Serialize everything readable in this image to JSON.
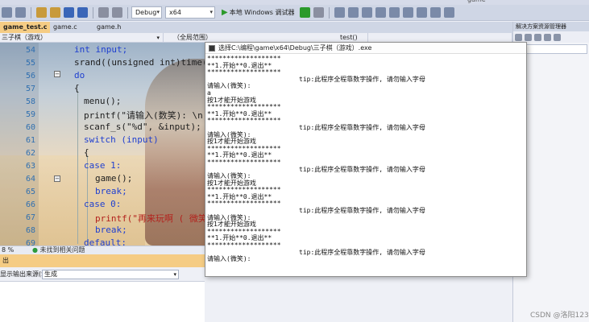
{
  "toolbar": {
    "config": "Debug",
    "platform": "x64",
    "run_label": "本地 Windows 调试器"
  },
  "title_bar": {
    "right_text": "game"
  },
  "tabs": [
    {
      "label": "game_test.c",
      "active": true
    },
    {
      "label": "game.c",
      "active": false
    },
    {
      "label": "game.h",
      "active": false
    }
  ],
  "nav": {
    "project": "三子棋（游戏）",
    "scope": "（全局范围）",
    "member": "test()"
  },
  "editor": {
    "lines": [
      {
        "n": "54",
        "text": "int input;"
      },
      {
        "n": "55",
        "text": "srand((unsigned int)time(NU"
      },
      {
        "n": "56",
        "text": "do"
      },
      {
        "n": "57",
        "text": "{"
      },
      {
        "n": "58",
        "text": "menu();"
      },
      {
        "n": "59",
        "text": "printf(\"请输入(数笑): \\n"
      },
      {
        "n": "60",
        "text": "scanf_s(\"%d\", &input);"
      },
      {
        "n": "61",
        "text": "switch (input)"
      },
      {
        "n": "62",
        "text": "{"
      },
      {
        "n": "63",
        "text": "case 1:"
      },
      {
        "n": "64",
        "text": "game();"
      },
      {
        "n": "65",
        "text": "break;"
      },
      {
        "n": "66",
        "text": "case 0:"
      },
      {
        "n": "67",
        "text": "printf(\"再来玩啊 ( 微笑"
      },
      {
        "n": "68",
        "text": "break;"
      },
      {
        "n": "69",
        "text": "default:"
      }
    ]
  },
  "status": {
    "zoom": "8 %",
    "issues": "未找到相关问题"
  },
  "output_panel": {
    "header": "出",
    "show_from_label": "显示输出来源(S):",
    "source": "生成"
  },
  "console": {
    "title": "选择C:\\编程\\game\\x64\\Debug\\三子棋（游戏）.exe",
    "lines": [
      {
        "text": "*******************",
        "tip": ""
      },
      {
        "text": "**1.开始**0.退出**",
        "tip": ""
      },
      {
        "text": "*******************",
        "tip": ""
      },
      {
        "text": "",
        "tip": "tip:此程序全程靠数字操作, 请勿输入字母"
      },
      {
        "text": "请输入(微笑):",
        "tip": ""
      },
      {
        "text": "a",
        "tip": ""
      },
      {
        "text": "按1才能开始游戏",
        "tip": ""
      },
      {
        "text": "*******************",
        "tip": ""
      },
      {
        "text": "**1.开始**0.退出**",
        "tip": ""
      },
      {
        "text": "*******************",
        "tip": ""
      },
      {
        "text": "",
        "tip": "tip:此程序全程靠数字操作, 请勿输入字母"
      },
      {
        "text": "请输入(微笑):",
        "tip": ""
      },
      {
        "text": "按1才能开始游戏",
        "tip": ""
      },
      {
        "text": "*******************",
        "tip": ""
      },
      {
        "text": "**1.开始**0.退出**",
        "tip": ""
      },
      {
        "text": "*******************",
        "tip": ""
      },
      {
        "text": "",
        "tip": "tip:此程序全程靠数字操作, 请勿输入字母"
      },
      {
        "text": "请输入(微笑):",
        "tip": ""
      },
      {
        "text": "按1才能开始游戏",
        "tip": ""
      },
      {
        "text": "*******************",
        "tip": ""
      },
      {
        "text": "**1.开始**0.退出**",
        "tip": ""
      },
      {
        "text": "*******************",
        "tip": ""
      },
      {
        "text": "",
        "tip": "tip:此程序全程靠数字操作, 请勿输入字母"
      },
      {
        "text": "请输入(微笑):",
        "tip": ""
      },
      {
        "text": "按1才能开始游戏",
        "tip": ""
      },
      {
        "text": "*******************",
        "tip": ""
      },
      {
        "text": "**1.开始**0.退出**",
        "tip": ""
      },
      {
        "text": "*******************",
        "tip": ""
      },
      {
        "text": "",
        "tip": "tip:此程序全程靠数字操作, 请勿输入字母"
      },
      {
        "text": "请输入(微笑):",
        "tip": ""
      }
    ]
  },
  "right_panel": {
    "title": "解决方案资源管理器"
  },
  "watermark": "CSDN @洛阳123"
}
